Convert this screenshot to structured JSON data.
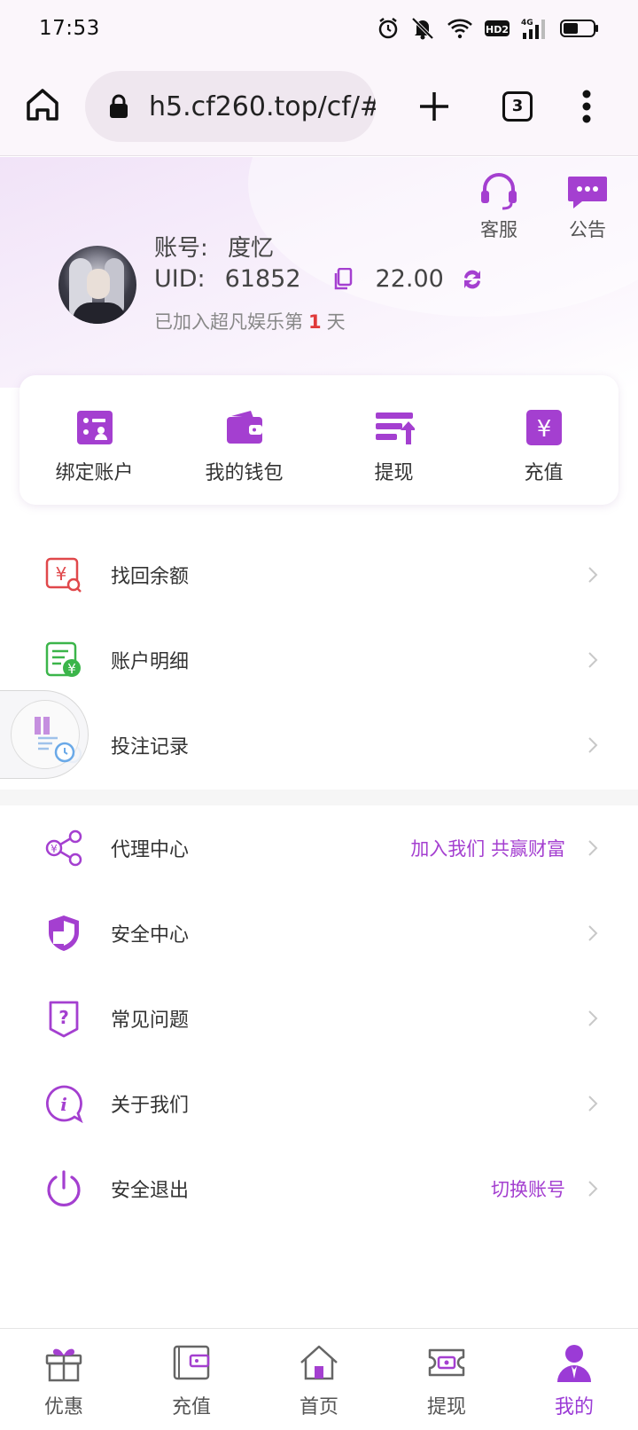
{
  "status_bar": {
    "time": "17:53",
    "network": "4G",
    "hd": "HD2"
  },
  "browser": {
    "url": "h5.cf260.top/cf/#",
    "tab_count": "3"
  },
  "header": {
    "service_label": "客服",
    "notice_label": "公告",
    "account_label": "账号:",
    "account_name": "度忆",
    "uid_label": "UID:",
    "uid_value": "61852",
    "balance": "22.00",
    "joined_prefix": "已加入超凡娱乐第",
    "joined_days": "1",
    "joined_suffix": "天"
  },
  "quick_actions": [
    {
      "label": "绑定账户",
      "icon": "bind-account-icon"
    },
    {
      "label": "我的钱包",
      "icon": "wallet-icon"
    },
    {
      "label": "提现",
      "icon": "withdraw-icon"
    },
    {
      "label": "充值",
      "icon": "recharge-icon"
    }
  ],
  "menu_group_1": [
    {
      "label": "找回余额",
      "icon": "recover-balance-icon"
    },
    {
      "label": "账户明细",
      "icon": "account-detail-icon"
    },
    {
      "label": "投注记录",
      "icon": "bet-record-icon"
    }
  ],
  "menu_group_2": [
    {
      "label": "代理中心",
      "extra": "加入我们 共赢财富",
      "icon": "agent-share-icon"
    },
    {
      "label": "安全中心",
      "extra": "",
      "icon": "shield-icon"
    },
    {
      "label": "常见问题",
      "extra": "",
      "icon": "question-icon"
    },
    {
      "label": "关于我们",
      "extra": "",
      "icon": "info-icon"
    },
    {
      "label": "安全退出",
      "extra": "切换账号",
      "icon": "power-icon"
    }
  ],
  "tab_bar": [
    {
      "label": "优惠",
      "icon": "gift-icon"
    },
    {
      "label": "充值",
      "icon": "recharge-wallet-icon"
    },
    {
      "label": "首页",
      "icon": "home-icon"
    },
    {
      "label": "提现",
      "icon": "cash-icon"
    },
    {
      "label": "我的",
      "icon": "user-icon",
      "active": true
    }
  ],
  "colors": {
    "accent": "#a43fd0",
    "accent_dark": "#8e2ec8",
    "red": "#e03a3a",
    "green": "#3bb54a"
  }
}
